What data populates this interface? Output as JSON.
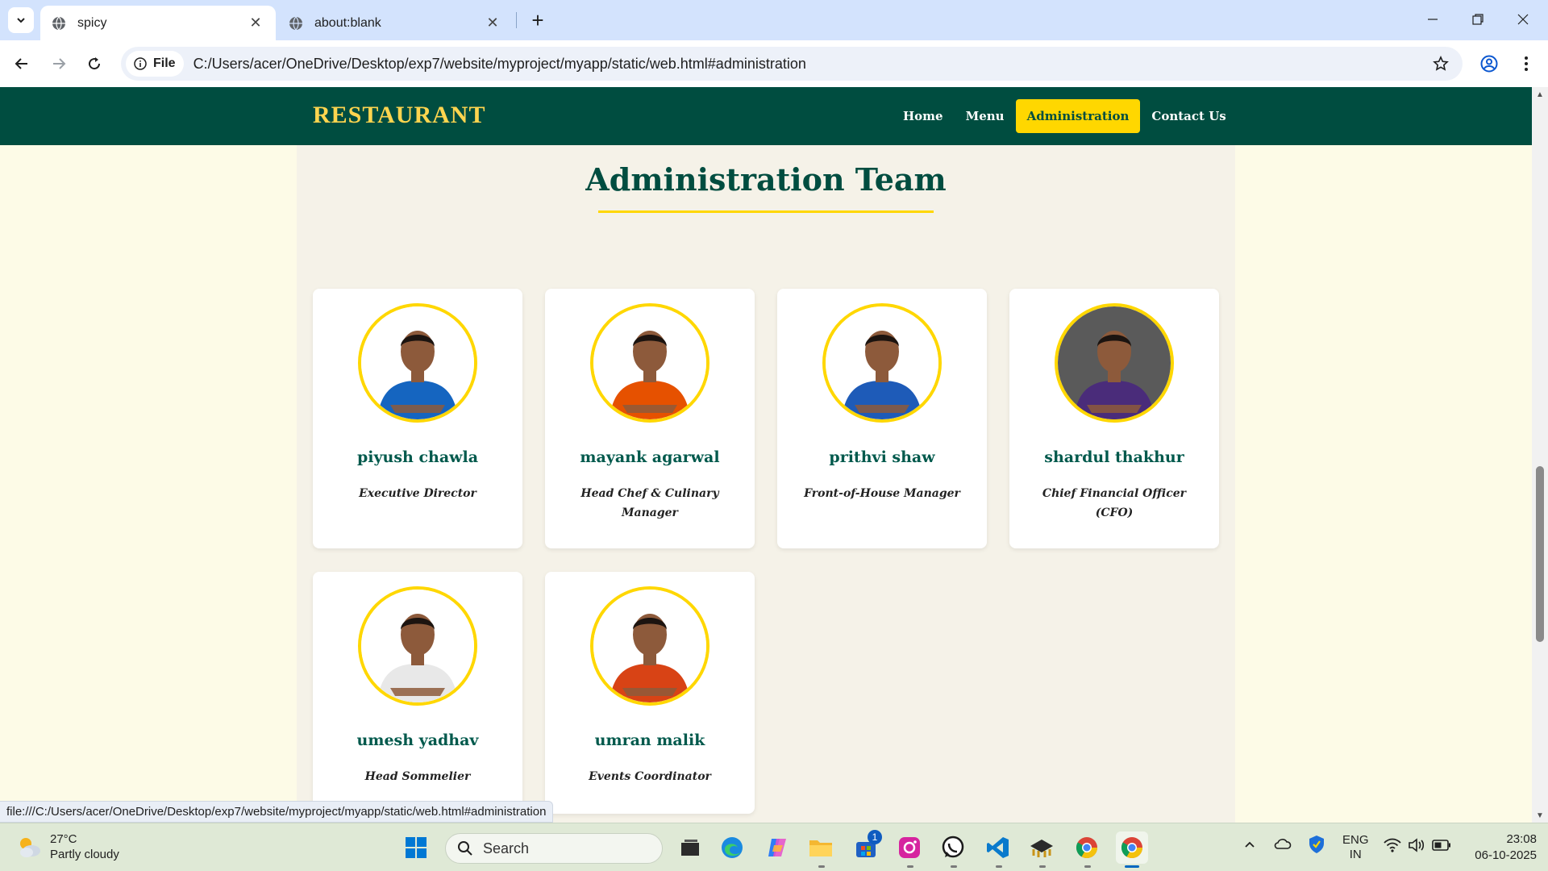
{
  "browser": {
    "tabs": [
      {
        "title": "spicy",
        "active": true
      },
      {
        "title": "about:blank",
        "active": false
      }
    ],
    "chip_label": "File",
    "url": "C:/Users/acer/OneDrive/Desktop/exp7/website/myproject/myapp/static/web.html#administration",
    "status_url": "file:///C:/Users/acer/OneDrive/Desktop/exp7/website/myproject/myapp/static/web.html#administration"
  },
  "site": {
    "brand": "RESTAURANT",
    "nav": [
      {
        "label": "Home",
        "active": false
      },
      {
        "label": "Menu",
        "active": false
      },
      {
        "label": "Administration",
        "active": true
      },
      {
        "label": "Contact Us",
        "active": false
      }
    ],
    "colors": {
      "primary": "#004d40",
      "accent": "#ffd700",
      "background": "#fdfbe7"
    }
  },
  "section": {
    "title": "Administration Team",
    "members": [
      {
        "name": "piyush chawla",
        "role": "Executive Director",
        "jersey": "#1565c0"
      },
      {
        "name": "mayank agarwal",
        "role": "Head Chef & Culinary Manager",
        "jersey": "#e65100"
      },
      {
        "name": "prithvi shaw",
        "role": "Front-of-House Manager",
        "jersey": "#1e5bb8"
      },
      {
        "name": "shardul thakhur",
        "role": "Chief Financial Officer (CFO)",
        "jersey": "#4a2c7a"
      },
      {
        "name": "umesh yadhav",
        "role": "Head Sommelier",
        "jersey": "#e8e8e8"
      },
      {
        "name": "umran malik",
        "role": "Events Coordinator",
        "jersey": "#d84315"
      }
    ]
  },
  "taskbar": {
    "weather_temp": "27°C",
    "weather_desc": "Partly cloudy",
    "search_label": "Search",
    "lang": "ENG",
    "region": "IN",
    "time": "23:08",
    "date": "06-10-2025",
    "store_badge": "1"
  }
}
